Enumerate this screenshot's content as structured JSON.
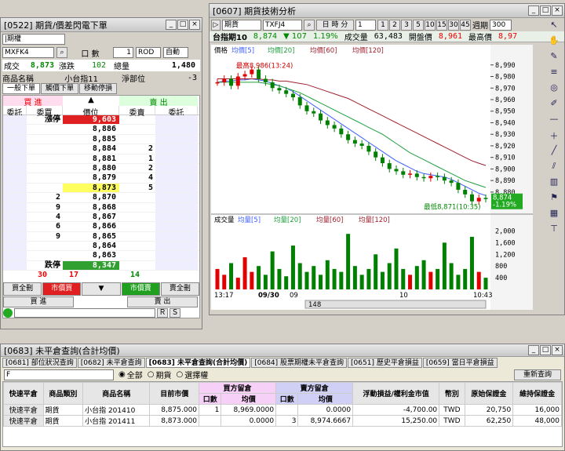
{
  "order_window": {
    "title": "[0522] 期貨/價差閃電下單",
    "acct_select": "|期權",
    "count_label": "口 數",
    "count_value": "1",
    "order_type": "ROD",
    "mode": "自動",
    "symbol": "MXFK4",
    "info": {
      "trade_label": "成交",
      "trade_value": "8,873",
      "change_label": "漲跌",
      "change_value": "102",
      "total_label": "總量",
      "total_value": "1,480",
      "name_label": "商品名稱",
      "name_value": "小台指11",
      "netpos_label": "淨部位",
      "netpos_value": "-3"
    },
    "tabs": [
      "一般下單",
      "觸價下單",
      "移動停損"
    ],
    "buy_header": "買 進",
    "sell_header": "賣 出",
    "col_headers": [
      "委託",
      "委買",
      "價位",
      "委賣",
      "委託"
    ],
    "up_limit_label": "漲停",
    "down_limit_label": "跌停",
    "ladder": [
      {
        "price": "9,603",
        "ask": "",
        "bid": "",
        "label": "漲停",
        "hl": "red"
      },
      {
        "price": "8,886",
        "ask": "",
        "bid": ""
      },
      {
        "price": "8,885",
        "ask": "",
        "bid": ""
      },
      {
        "price": "8,884",
        "ask": "2",
        "bid": ""
      },
      {
        "price": "8,881",
        "ask": "1",
        "bid": ""
      },
      {
        "price": "8,880",
        "ask": "2",
        "bid": ""
      },
      {
        "price": "8,879",
        "ask": "4",
        "bid": ""
      },
      {
        "price": "8,873",
        "ask": "5",
        "bid": "",
        "hl": "yellow"
      },
      {
        "price": "8,870",
        "ask": "",
        "bid": "2"
      },
      {
        "price": "8,868",
        "ask": "",
        "bid": "9"
      },
      {
        "price": "8,867",
        "ask": "",
        "bid": "4"
      },
      {
        "price": "8,866",
        "ask": "",
        "bid": "6"
      },
      {
        "price": "8,865",
        "ask": "",
        "bid": "9"
      },
      {
        "price": "8,864",
        "ask": "",
        "bid": ""
      },
      {
        "price": "8,863",
        "ask": "",
        "bid": ""
      },
      {
        "price": "8,347",
        "ask": "",
        "bid": "",
        "label": "跌停",
        "hl": "green"
      }
    ],
    "totals": {
      "buy_orders": "30",
      "bid_total": "17",
      "ask_total": "14"
    },
    "bottom_buttons": [
      "買全刪",
      "市價買",
      "▼",
      "市價賣",
      "賣全刪"
    ],
    "buy_label": "買 進",
    "sell_label": "賣 出",
    "small_buttons": [
      "Ｒ",
      "Ｓ"
    ]
  },
  "chart_window": {
    "title": "[0607] 期貨技術分析",
    "product": "期貨",
    "symbol": "TXFJ4",
    "period_label": "日 時 分",
    "range_buttons": [
      "1",
      "2",
      "3",
      "5",
      "10",
      "15",
      "30",
      "45"
    ],
    "period_text": "週期",
    "period_value": "300",
    "quote": {
      "name": "台指期10",
      "price": "8,874",
      "change": "▼ 107",
      "pct": "1.19%",
      "vol_label": "成交量",
      "vol": "63,483",
      "open_label": "開盤價",
      "open": "8,961",
      "high_label": "最高價",
      "high": "8,97"
    },
    "price_legend": {
      "label": "價格",
      "ma5": "均價[5]",
      "ma20": "均價[20]",
      "ma60": "均價[60]",
      "ma120": "均價[120]"
    },
    "vol_legend": {
      "label": "成交量",
      "ma5": "均量[5]",
      "ma20": "均量[20]",
      "ma60": "均量[60]",
      "ma120": "均量[120]"
    },
    "high_note": "最高8,986(13:24)",
    "low_note": "最低8,871(10:35)",
    "cur_price": "8,874",
    "cur_pct": "-1.19%",
    "x_labels": [
      "13:17",
      "09/30",
      "09",
      "10",
      "10:43"
    ],
    "zoom_value": "148",
    "colors": {
      "up": "#e00000",
      "down": "#008000",
      "ma5": "#4060ff",
      "ma20": "#20a040",
      "ma60": "#a02030"
    }
  },
  "chart_data": [
    {
      "type": "line",
      "title": "",
      "y_ticks": [
        8990,
        8980,
        8970,
        8960,
        8950,
        8940,
        8930,
        8920,
        8910,
        8900,
        8890,
        8880
      ],
      "ylim": [
        8865,
        8998
      ],
      "series": [
        {
          "name": "價格",
          "values": [
            8975,
            8978,
            8972,
            8980,
            8982,
            8986,
            8978,
            8975,
            8970,
            8968,
            8965,
            8962,
            8955,
            8950,
            8948,
            8942,
            8938,
            8935,
            8930,
            8925,
            8922,
            8920,
            8915,
            8910,
            8905,
            8900,
            8898,
            8895,
            8896,
            8893,
            8892,
            8894,
            8893,
            8890,
            8888,
            8882,
            8878,
            8872,
            8875,
            8874
          ]
        },
        {
          "name": "均價[20]",
          "values": [
            8975,
            8976,
            8976,
            8977,
            8977,
            8978,
            8977,
            8976,
            8974,
            8972,
            8970,
            8967,
            8963,
            8959,
            8955,
            8951,
            8947,
            8943,
            8939,
            8935,
            8931,
            8927,
            8923,
            8919,
            8915,
            8911,
            8907,
            8904,
            8901,
            8898,
            8896,
            8895,
            8894,
            8893,
            8891,
            8888,
            8885,
            8882,
            8879,
            8877
          ]
        },
        {
          "name": "均價[60]",
          "values": [
            8975,
            8975,
            8975,
            8975,
            8975,
            8975,
            8975,
            8974,
            8973,
            8972,
            8970,
            8968,
            8966,
            8963,
            8960,
            8957,
            8954,
            8951,
            8948,
            8945,
            8942,
            8939,
            8936,
            8933,
            8930,
            8926,
            8922,
            8918,
            8914,
            8911,
            8908,
            8905,
            8902,
            8899,
            8896,
            8893,
            8890,
            8888,
            8886,
            8884
          ]
        },
        {
          "name": "均價[120]",
          "values": [
            8978,
            8978,
            8978,
            8978,
            8978,
            8978,
            8978,
            8977,
            8977,
            8976,
            8976,
            8975,
            8974,
            8973,
            8971,
            8969,
            8967,
            8965,
            8963,
            8961,
            8958,
            8955,
            8952,
            8949,
            8946,
            8943,
            8940,
            8937,
            8934,
            8931,
            8928,
            8925,
            8922,
            8919,
            8916,
            8913,
            8910,
            8907,
            8905,
            8903
          ]
        }
      ]
    },
    {
      "type": "bar",
      "title": "成交量",
      "y_ticks": [
        2000,
        1600,
        1200,
        800,
        400
      ],
      "ylim": [
        0,
        2200
      ],
      "values": [
        700,
        500,
        900,
        400,
        1100,
        600,
        800,
        500,
        1300,
        700,
        450,
        1500,
        900,
        600,
        800,
        500,
        1000,
        700,
        600,
        1900,
        800,
        500,
        700,
        1200,
        600,
        900,
        1400,
        700,
        500,
        800,
        1000,
        600,
        700,
        1600,
        900,
        500,
        700,
        1800,
        600,
        400
      ]
    }
  ],
  "query_window": {
    "title": "[0683] 未平倉查詢(合計均價)",
    "tabs": [
      "[0681] 部位狀況查詢",
      "[0682] 未平倉查詢",
      "[0683] 未平倉查詢(合計均價)",
      "[0684] 股票期權未平倉查詢",
      "[0651] 歷史平倉損益",
      "[0659] 當日平倉損益"
    ],
    "account": "F",
    "radios": [
      "全部",
      "期貨",
      "選擇權"
    ],
    "refresh_label": "重新查詢",
    "headers": {
      "quick": "快速平倉",
      "type": "商品類別",
      "name": "商品名稱",
      "mkt": "目前市價",
      "buy_group": "買方留倉",
      "sell_group": "賣方留倉",
      "qty": "口數",
      "avg": "均價",
      "pnl": "浮動損益/權利金市值",
      "ccy": "幣別",
      "init": "原始保證金",
      "maint": "維持保證金"
    },
    "rows": [
      {
        "quick": "快速平倉",
        "type": "期貨",
        "name": "小台指 201410",
        "mkt": "8,875.000",
        "bqty": "1",
        "bavg": "8,969.0000",
        "sqty": "",
        "savg": "0.0000",
        "pnl": "-4,700.00",
        "ccy": "TWD",
        "init": "20,750",
        "maint": "16,000"
      },
      {
        "quick": "快速平倉",
        "type": "期貨",
        "name": "小台指 201411",
        "mkt": "8,873.000",
        "bqty": "",
        "bavg": "0.0000",
        "sqty": "3",
        "savg": "8,974.6667",
        "pnl": "15,250.00",
        "ccy": "TWD",
        "init": "62,250",
        "maint": "48,000"
      }
    ]
  }
}
